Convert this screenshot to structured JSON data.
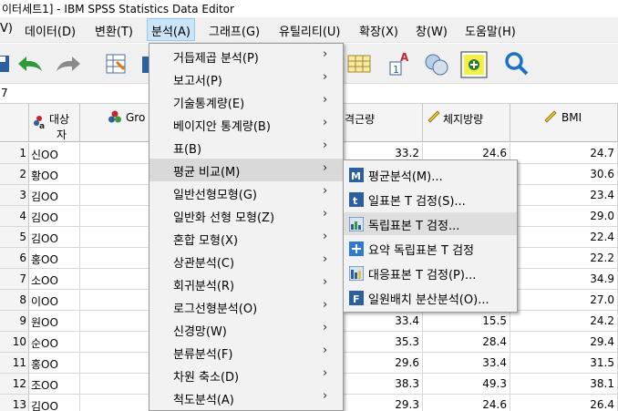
{
  "window": {
    "title": "이터세트1] - IBM SPSS Statistics Data Editor"
  },
  "menubar": {
    "items": [
      "V)",
      "데이터(D)",
      "변환(T)",
      "분석(A)",
      "그래프(G)",
      "유틸리티(U)",
      "확장(X)",
      "창(W)",
      "도움말(H)"
    ]
  },
  "cell_ref": "7",
  "columns": {
    "c1": "대상자",
    "c1_line1": "대상",
    "c1_line2": "자",
    "c2": "Gro",
    "c3": "격근량",
    "c4": "체지방량",
    "c5": "BMI"
  },
  "rows": [
    {
      "n": "1",
      "name": "신OO",
      "a": "33.2",
      "b": "24.6",
      "c": "24.7"
    },
    {
      "n": "2",
      "name": "황OO",
      "a": "",
      "b": "",
      "c": "30.6"
    },
    {
      "n": "3",
      "name": "김OO",
      "a": "",
      "b": "",
      "c": "23.4"
    },
    {
      "n": "4",
      "name": "김OO",
      "a": "",
      "b": "",
      "c": "29.0"
    },
    {
      "n": "5",
      "name": "김OO",
      "a": "",
      "b": "",
      "c": "22.4"
    },
    {
      "n": "6",
      "name": "홍OO",
      "a": "",
      "b": "",
      "c": "22.2"
    },
    {
      "n": "7",
      "name": "소OO",
      "a": "",
      "b": "",
      "c": "34.9"
    },
    {
      "n": "8",
      "name": "이OO",
      "a": "",
      "b": "",
      "c": "27.0"
    },
    {
      "n": "9",
      "name": "원OO",
      "a": "33.4",
      "b": "15.5",
      "c": "24.2"
    },
    {
      "n": "10",
      "name": "순OO",
      "a": "35.3",
      "b": "28.4",
      "c": "29.4"
    },
    {
      "n": "11",
      "name": "홍OO",
      "a": "29.6",
      "b": "33.4",
      "c": "31.5"
    },
    {
      "n": "12",
      "name": "조OO",
      "a": "38.3",
      "b": "49.3",
      "c": "38.1"
    },
    {
      "n": "13",
      "name": "김OO",
      "a": "29.3",
      "b": "24.6",
      "c": "26.4"
    }
  ],
  "analyze_menu": [
    "거듭제곱 분석(P)",
    "보고서(P)",
    "기술통계량(E)",
    "베이지안 통계량(B)",
    "표(B)",
    "평균 비교(M)",
    "일반선형모형(G)",
    "일반화 선형 모형(Z)",
    "혼합 모형(X)",
    "상관분석(C)",
    "회귀분석(R)",
    "로그선형분석(O)",
    "신경망(W)",
    "분류분석(F)",
    "차원 축소(D)",
    "척도분석(A)"
  ],
  "compare_means_menu": [
    "평균분석(M)...",
    "일표본 T 검정(S)...",
    "독립표본 T 검정...",
    "요약 독립표본 T 검정",
    "대응표본 T 검정(P)...",
    "일원배치 분산분석(O)..."
  ],
  "colors": {
    "menu_highlight": "#d9d9d9",
    "active_menu": "#cce4f7",
    "accent_blue": "#1f6fc4"
  }
}
